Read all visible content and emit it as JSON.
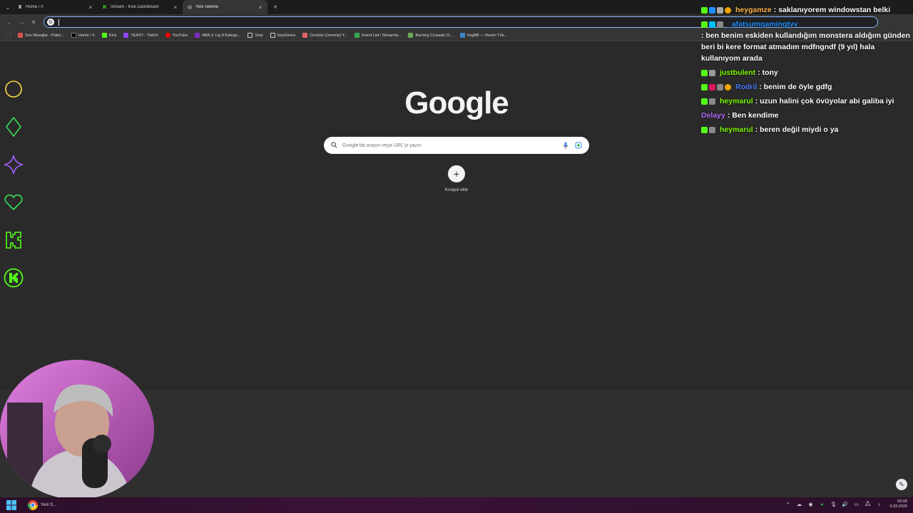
{
  "browser": {
    "tabs": [
      {
        "title": "Home / X",
        "favicon": "x-logo-icon"
      },
      {
        "title": "Stream - Kick Dashboard",
        "favicon": "kick-logo-icon"
      },
      {
        "title": "Yeni Sekme",
        "favicon": "chrome-icon",
        "active": true
      }
    ],
    "omnibox": {
      "value": "",
      "placeholder": ""
    },
    "bookmarks": [
      "Son Mesajlar - Patici...",
      "Home / X",
      "Kick",
      "TEASY - Twitch",
      "YouTube",
      "NBA 3. Lig 8 Katego...",
      "Vorp",
      "KeyGivers",
      "Ücretsiz Çevrimiçi Y...",
      "Event List / Streamla...",
      "Burning Crusade Cl...",
      "ImgBB — Resim Yük..."
    ]
  },
  "newtab": {
    "logo": "Google",
    "search_placeholder": "Google'da arayın veya URL'yi yazın",
    "shortcut_label": "Kısayol ekle"
  },
  "chat": {
    "messages": [
      {
        "user": "heygamze",
        "user_color": "#ffb347",
        "text": ": saklanıyorem windowstan belki"
      },
      {
        "user": "_afatsumgamingtvv",
        "user_color": "#1e90ff",
        "text": ": ben benim eskiden kullandığım monstera aldığım günden beri bi kere format atmadım mdfngndf (9 yıl) hala kullanıyom arada"
      },
      {
        "user": "justbulent",
        "user_color": "#7cfc00",
        "text": ": tony"
      },
      {
        "user": "Rodril",
        "user_color": "#4a7dff",
        "text": ": benim de öyle gdfg"
      },
      {
        "user": "heymarul",
        "user_color": "#7cfc00",
        "text": ": uzun halini çok övüyolar abi galiba iyi"
      },
      {
        "user": "Delayy",
        "user_color": "#b36bff",
        "text": ": Ben kendime"
      },
      {
        "user": "heymarul",
        "user_color": "#7cfc00",
        "text": ": beren değil miydi o ya"
      }
    ]
  },
  "taskbar": {
    "chrome_label": "Yeni S...",
    "time": "00:06",
    "date": "6.03.2026"
  },
  "colors": {
    "kick_green": "#53fc18",
    "omnibox_focus": "#8ab4f8",
    "page_bg": "#2a2a2a"
  }
}
